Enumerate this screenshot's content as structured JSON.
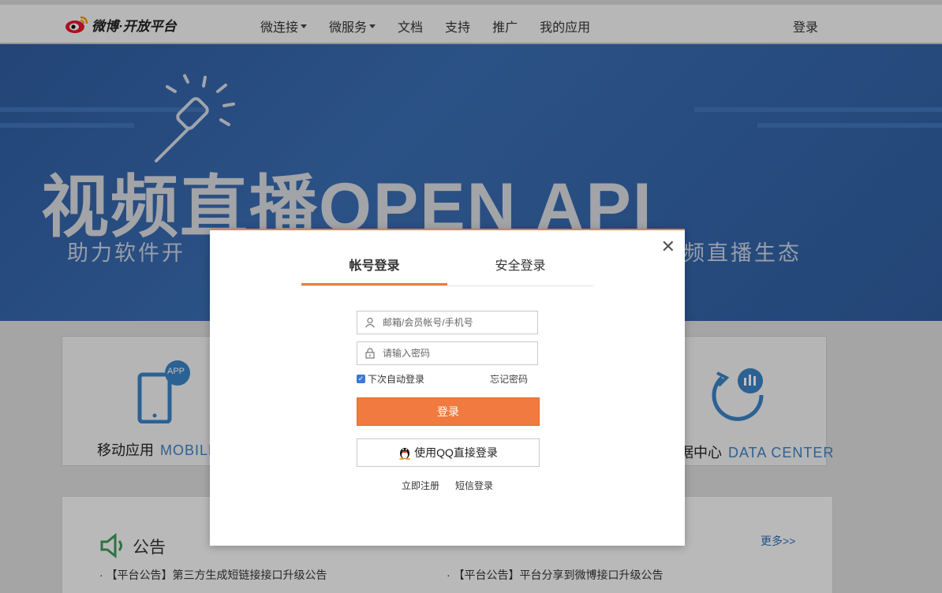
{
  "header": {
    "logo_text": "微博·开放平台",
    "nav": [
      {
        "label": "微连接",
        "dropdown": true
      },
      {
        "label": "微服务",
        "dropdown": true
      },
      {
        "label": "文档",
        "dropdown": false
      },
      {
        "label": "支持",
        "dropdown": false
      },
      {
        "label": "推广",
        "dropdown": false
      },
      {
        "label": "我的应用",
        "dropdown": false
      }
    ],
    "login_label": "登录"
  },
  "banner": {
    "title": "视频直播OPEN API",
    "subtitle_left": "助力软件开",
    "subtitle_right": "频直播生态"
  },
  "cards": {
    "mobile": {
      "label": "移动应用",
      "en": "MOBILE",
      "badge": "APP"
    },
    "data": {
      "label": "据中心",
      "en": "DATA CENTER"
    }
  },
  "notice": {
    "title": "公告",
    "more": "更多>>",
    "items_left": [
      "【平台公告】第三方生成短链接接口升级公告"
    ],
    "items_right": [
      "【平台公告】平台分享到微博接口升级公告"
    ]
  },
  "modal": {
    "tabs": [
      {
        "label": "帐号登录",
        "active": true
      },
      {
        "label": "安全登录",
        "active": false
      }
    ],
    "username_placeholder": "邮箱/会员帐号/手机号",
    "password_placeholder": "请输入密码",
    "remember_label": "下次自动登录",
    "remember_checked": true,
    "forgot_label": "忘记密码",
    "login_button": "登录",
    "qq_button": "使用QQ直接登录",
    "register_link": "立即注册",
    "sms_link": "短信登录",
    "close_symbol": "✕"
  },
  "colors": {
    "accent": "#f07a3f",
    "banner_blue": "#3a6db3",
    "link_blue": "#2f6db4"
  }
}
